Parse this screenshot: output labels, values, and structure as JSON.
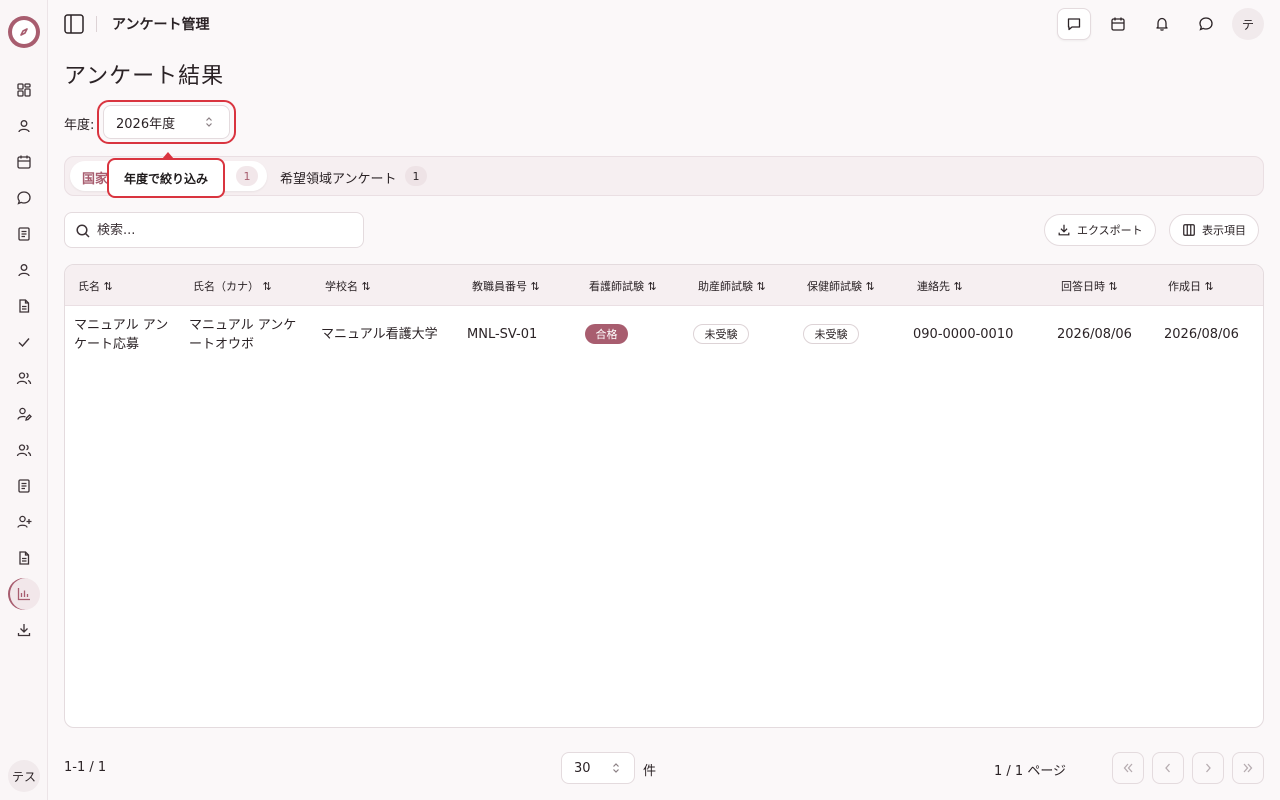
{
  "sidebar": {
    "user_initials": "テス"
  },
  "header": {
    "title": "アンケート管理",
    "avatar": "テ"
  },
  "page": {
    "title": "アンケート結果",
    "year_label": "年度:",
    "year_value": "2026年度",
    "tooltip": "年度で絞り込み"
  },
  "tabs": [
    {
      "label": "国家試験アンケート",
      "count": "1"
    },
    {
      "label": "希望領域アンケート",
      "count": "1"
    }
  ],
  "search": {
    "placeholder": "検索..."
  },
  "actions": {
    "export": "エクスポート",
    "columns": "表示項目"
  },
  "table": {
    "columns": [
      "氏名 ⇅",
      "氏名（カナ） ⇅",
      "学校名 ⇅",
      "教職員番号 ⇅",
      "看護師試験 ⇅",
      "助産師試験 ⇅",
      "保健師試験 ⇅",
      "連絡先 ⇅",
      "回答日時 ⇅",
      "作成日 ⇅"
    ],
    "rows": [
      {
        "name": "マニュアル アンケート応募",
        "kana": "マニュアル アンケートオウボ",
        "school": "マニュアル看護大学",
        "staff_no": "MNL-SV-01",
        "nurse": "合格",
        "midwife": "未受験",
        "public_health": "未受験",
        "contact": "090-0000-0010",
        "answered": "2026/08/06",
        "created": "2026/08/06"
      }
    ]
  },
  "footer": {
    "range": "1-1 / 1",
    "page_size": "30",
    "unit": "件",
    "page_info": "1 / 1 ページ"
  },
  "colors": {
    "accent": "#a85d6f",
    "highlight": "#d9343f"
  }
}
